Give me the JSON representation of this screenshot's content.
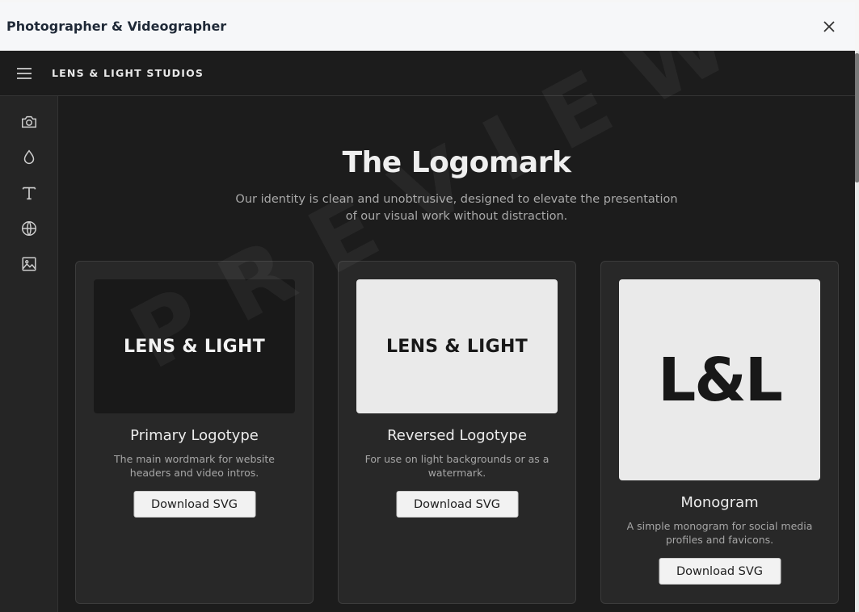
{
  "window": {
    "title": "Photographer & Videographer",
    "close_icon": "close-icon"
  },
  "app": {
    "brand": "LENS & LIGHT STUDIOS",
    "sidebar": [
      {
        "icon": "camera-icon"
      },
      {
        "icon": "droplet-icon"
      },
      {
        "icon": "type-icon"
      },
      {
        "icon": "globe-icon"
      },
      {
        "icon": "image-icon"
      }
    ]
  },
  "main": {
    "title": "The Logomark",
    "subtitle": "Our identity is clean and unobtrusive, designed to elevate the presentation of our visual work without distraction.",
    "watermark": "PREVIEW",
    "cards": [
      {
        "preview_text": "LENS & LIGHT",
        "name": "Primary Logotype",
        "description": "The main wordmark for website headers and video intros.",
        "button": "Download SVG"
      },
      {
        "preview_text": "LENS & LIGHT",
        "name": "Reversed Logotype",
        "description": "For use on light backgrounds or as a watermark.",
        "button": "Download SVG"
      },
      {
        "preview_text": "L&L",
        "name": "Monogram",
        "description": "A simple monogram for social media profiles and favicons.",
        "button": "Download SVG"
      }
    ]
  },
  "colors": {
    "background": "#1c1c1c",
    "card": "#282828",
    "button": "#f2f2f2",
    "light_preview": "#eaeaea"
  }
}
